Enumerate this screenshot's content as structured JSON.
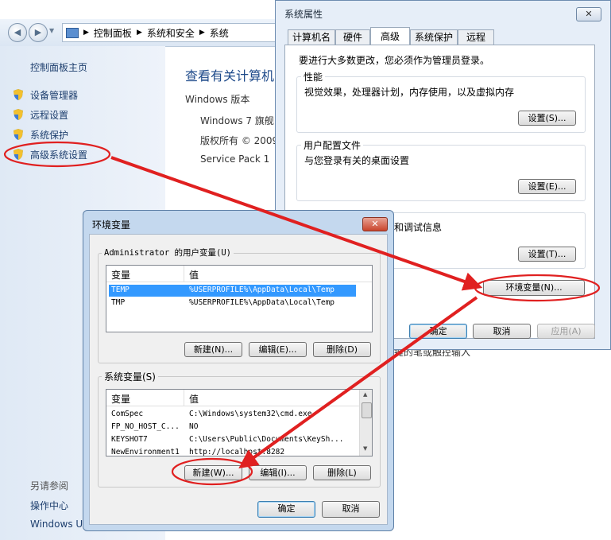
{
  "control_panel": {
    "breadcrumb": [
      "控制面板",
      "系统和安全",
      "系统"
    ],
    "sidebar": {
      "home": "控制面板主页",
      "items": [
        {
          "label": "设备管理器",
          "icon": "shield-icon"
        },
        {
          "label": "远程设置",
          "icon": "shield-icon"
        },
        {
          "label": "系统保护",
          "icon": "shield-icon"
        },
        {
          "label": "高级系统设置",
          "icon": "shield-icon"
        }
      ],
      "see_also": "另请参阅",
      "links": [
        "操作中心",
        "Windows U"
      ]
    },
    "main": {
      "title": "查看有关计算机",
      "edition_label": "Windows 版本",
      "edition": "Windows 7 旗舰",
      "copyright": "版权所有 © 2009",
      "service_pack": "Service Pack 1",
      "partial_text": "键的笔或触控输入"
    }
  },
  "system_properties": {
    "title": "系统属性",
    "close_label": "✕",
    "tabs": [
      "计算机名",
      "硬件",
      "高级",
      "系统保护",
      "远程"
    ],
    "active_tab": "高级",
    "admin_note": "要进行大多数更改，您必须作为管理员登录。",
    "performance": {
      "title": "性能",
      "desc": "视觉效果，处理器计划，内存使用，以及虚拟内存",
      "button": "设置(S)..."
    },
    "profiles": {
      "title": "用户配置文件",
      "desc": "与您登录有关的桌面设置",
      "button": "设置(E)..."
    },
    "startup": {
      "desc": "和调试信息",
      "button": "设置(T)..."
    },
    "env_button": "环境变量(N)...",
    "ok": "确定",
    "cancel": "取消",
    "apply": "应用(A)"
  },
  "environment_variables": {
    "title": "环境变量",
    "close_label": "✕",
    "user_group": "Administrator 的用户变量(U)",
    "col_var": "变量",
    "col_val": "值",
    "user_vars": [
      {
        "name": "TEMP",
        "value": "%USERPROFILE%\\AppData\\Local\\Temp",
        "selected": true
      },
      {
        "name": "TMP",
        "value": "%USERPROFILE%\\AppData\\Local\\Temp",
        "selected": false
      }
    ],
    "user_buttons": {
      "new": "新建(N)...",
      "edit": "编辑(E)...",
      "delete": "删除(D)"
    },
    "system_group": "系统变量(S)",
    "system_vars": [
      {
        "name": "ComSpec",
        "value": "C:\\Windows\\system32\\cmd.exe"
      },
      {
        "name": "FP_NO_HOST_C...",
        "value": "NO"
      },
      {
        "name": "KEYSHOT7",
        "value": "C:\\Users\\Public\\Documents\\KeySh..."
      },
      {
        "name": "NewEnvironment1",
        "value": "http://localhost:8282"
      }
    ],
    "system_buttons": {
      "new": "新建(W)...",
      "edit": "编辑(I)...",
      "delete": "删除(L)"
    },
    "ok": "确定",
    "cancel": "取消"
  },
  "annotation_color": "#e02020"
}
